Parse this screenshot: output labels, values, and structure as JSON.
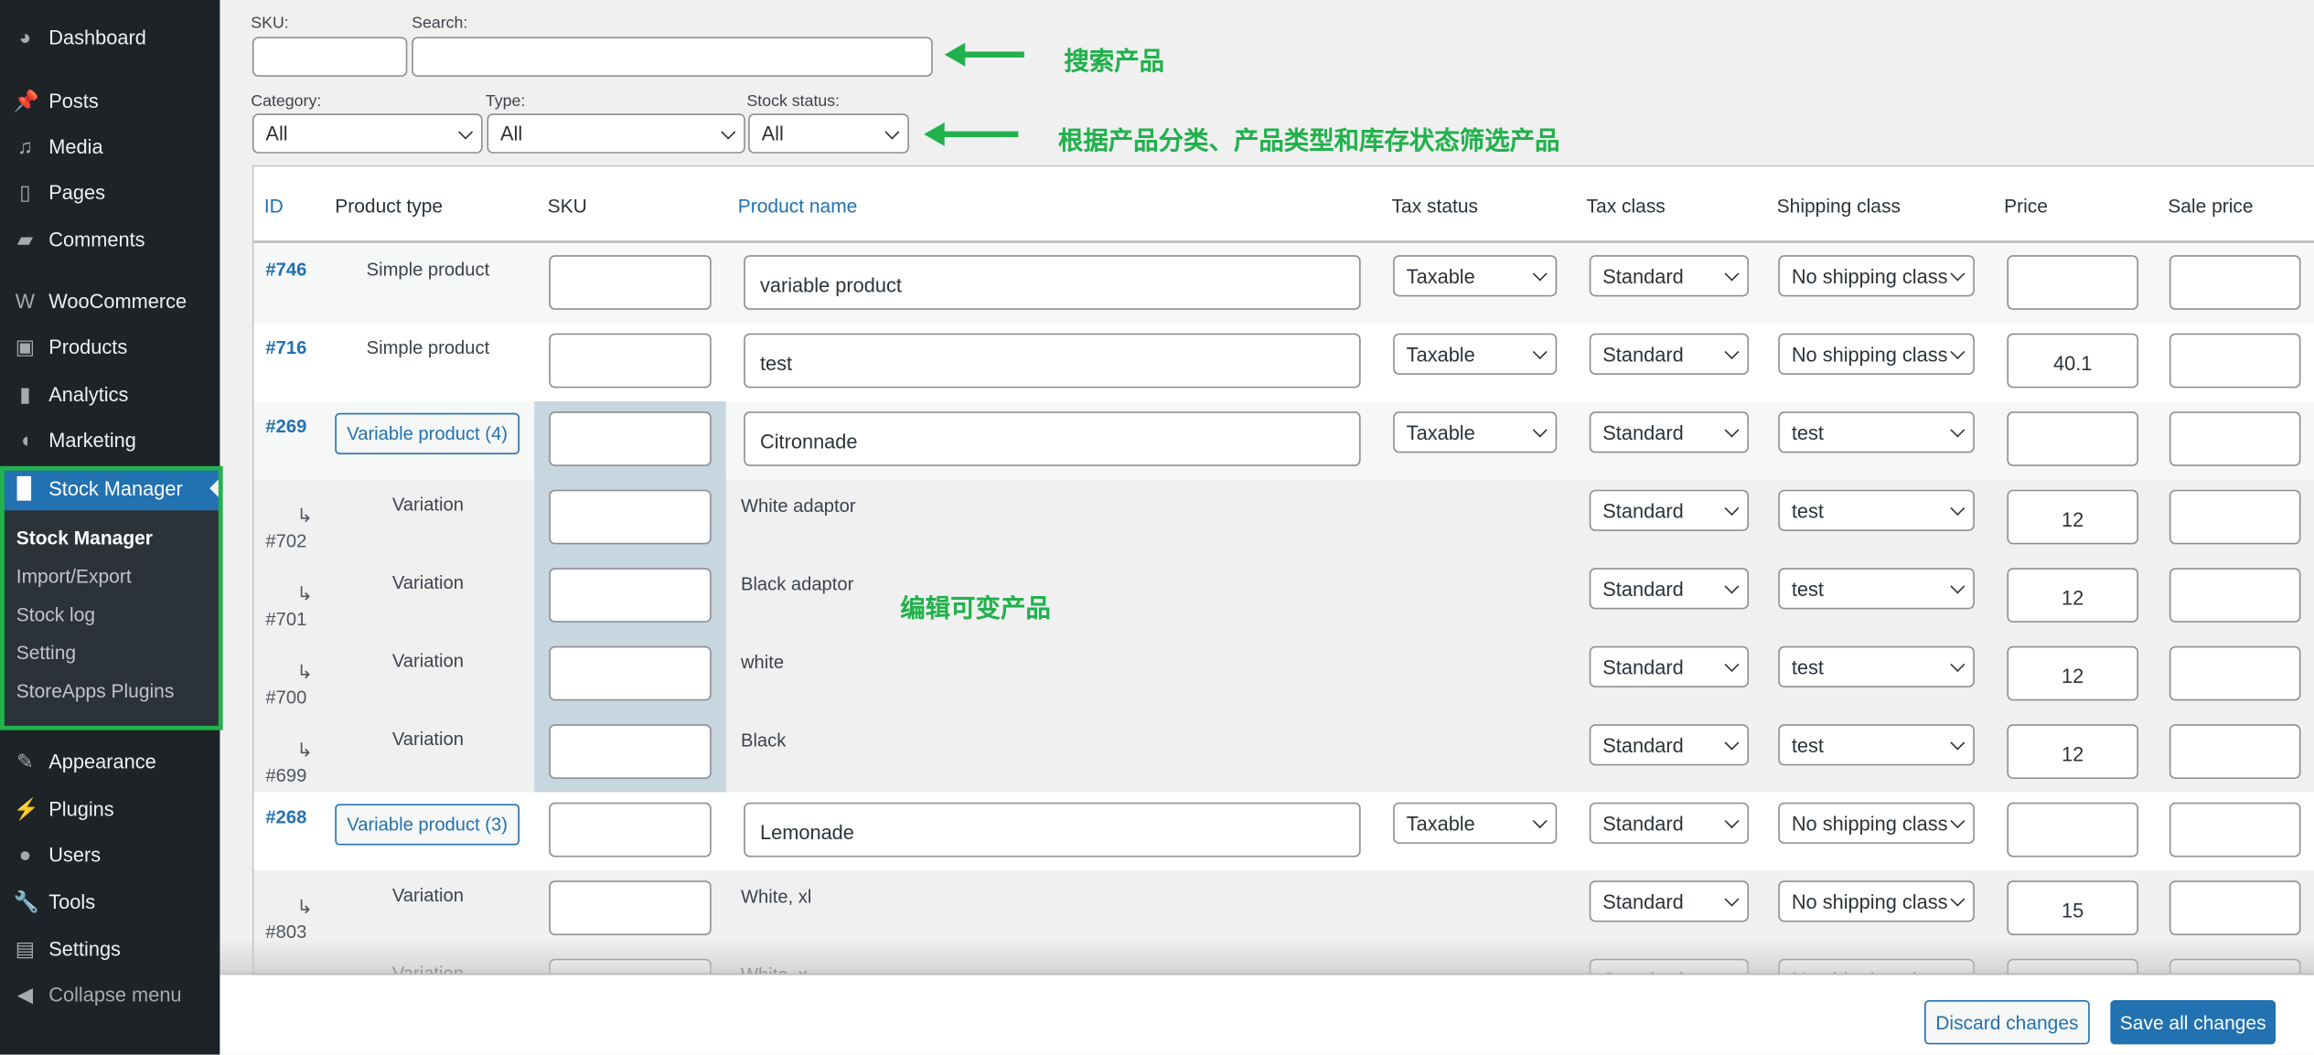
{
  "sidebar": {
    "items": [
      {
        "label": "Dashboard",
        "icon": "dashboard-icon",
        "glyph": "◕"
      },
      {
        "label": "Posts",
        "icon": "pin-icon",
        "glyph": "📌"
      },
      {
        "label": "Media",
        "icon": "media-icon",
        "glyph": "♫"
      },
      {
        "label": "Pages",
        "icon": "pages-icon",
        "glyph": "▯"
      },
      {
        "label": "Comments",
        "icon": "comment-icon",
        "glyph": "▰"
      },
      {
        "label": "WooCommerce",
        "icon": "woocommerce-icon",
        "glyph": "W"
      },
      {
        "label": "Products",
        "icon": "archive-icon",
        "glyph": "▣"
      },
      {
        "label": "Analytics",
        "icon": "bar-chart-icon",
        "glyph": "▮"
      },
      {
        "label": "Marketing",
        "icon": "megaphone-icon",
        "glyph": "◖"
      },
      {
        "label": "Stock Manager",
        "icon": "book-icon",
        "glyph": "▉",
        "active": true
      },
      {
        "label": "Appearance",
        "icon": "brush-icon",
        "glyph": "✎"
      },
      {
        "label": "Plugins",
        "icon": "plugin-icon",
        "glyph": "⚡"
      },
      {
        "label": "Users",
        "icon": "user-icon",
        "glyph": "●"
      },
      {
        "label": "Tools",
        "icon": "wrench-icon",
        "glyph": "🔧"
      },
      {
        "label": "Settings",
        "icon": "sliders-icon",
        "glyph": "▤"
      },
      {
        "label": "Collapse menu",
        "icon": "collapse-icon",
        "glyph": "◀"
      }
    ],
    "submenu": [
      "Stock Manager",
      "Import/Export",
      "Stock log",
      "Setting",
      "StoreApps Plugins"
    ]
  },
  "filters": {
    "sku_label": "SKU:",
    "sku_value": "",
    "search_label": "Search:",
    "search_value": "",
    "category_label": "Category:",
    "category_value": "All",
    "type_label": "Type:",
    "type_value": "All",
    "stock_label": "Stock status:",
    "stock_value": "All"
  },
  "annotations": {
    "search": "搜索产品",
    "filter": "根据产品分类、产品类型和库存状态筛选产品",
    "variable": "编辑可变产品",
    "color": "#22b14c"
  },
  "table": {
    "headers": [
      "ID",
      "Product type",
      "SKU",
      "Product name",
      "Tax status",
      "Tax class",
      "Shipping class",
      "Price",
      "Sale price"
    ],
    "rows": [
      {
        "kind": "simple",
        "id": "#746",
        "type": "Simple product",
        "sku": "",
        "name": "variable product",
        "tax_status": "Taxable",
        "tax_class": "Standard",
        "shipping": "No shipping class",
        "price": "",
        "sale": ""
      },
      {
        "kind": "simple",
        "id": "#716",
        "type": "Simple product",
        "sku": "",
        "name": "test",
        "tax_status": "Taxable",
        "tax_class": "Standard",
        "shipping": "No shipping class",
        "price": "40.1",
        "sale": ""
      },
      {
        "kind": "variable",
        "id": "#269",
        "type": "Variable product (4)",
        "sku": "",
        "name": "Citronnade",
        "tax_status": "Taxable",
        "tax_class": "Standard",
        "shipping": "test",
        "price": "",
        "sale": ""
      },
      {
        "kind": "variation",
        "arrow": "↳",
        "id": "#702",
        "type": "Variation",
        "sku": "",
        "name": "White adaptor",
        "tax_class": "Standard",
        "shipping": "test",
        "price": "12",
        "sale": ""
      },
      {
        "kind": "variation",
        "arrow": "↳",
        "id": "#701",
        "type": "Variation",
        "sku": "",
        "name": "Black adaptor",
        "tax_class": "Standard",
        "shipping": "test",
        "price": "12",
        "sale": ""
      },
      {
        "kind": "variation",
        "arrow": "↳",
        "id": "#700",
        "type": "Variation",
        "sku": "",
        "name": "white",
        "tax_class": "Standard",
        "shipping": "test",
        "price": "12",
        "sale": ""
      },
      {
        "kind": "variation",
        "arrow": "↳",
        "id": "#699",
        "type": "Variation",
        "sku": "",
        "name": "Black",
        "tax_class": "Standard",
        "shipping": "test",
        "price": "12",
        "sale": ""
      },
      {
        "kind": "variable",
        "id": "#268",
        "type": "Variable product (3)",
        "sku": "",
        "name": "Lemonade",
        "tax_status": "Taxable",
        "tax_class": "Standard",
        "shipping": "No shipping class",
        "price": "",
        "sale": ""
      },
      {
        "kind": "variation",
        "arrow": "↳",
        "id": "#803",
        "type": "Variation",
        "sku": "",
        "name": "White, xl",
        "tax_class": "Standard",
        "shipping": "No shipping class",
        "price": "15",
        "sale": ""
      },
      {
        "kind": "variation",
        "arrow": "↳",
        "id": "",
        "type": "Variation",
        "sku": "",
        "name": "White, x",
        "tax_class": "Standard",
        "shipping": "No shipping class",
        "price": "",
        "sale": ""
      }
    ]
  },
  "footer": {
    "discard": "Discard changes",
    "save": "Save all changes",
    "accent": "#2271b1"
  }
}
